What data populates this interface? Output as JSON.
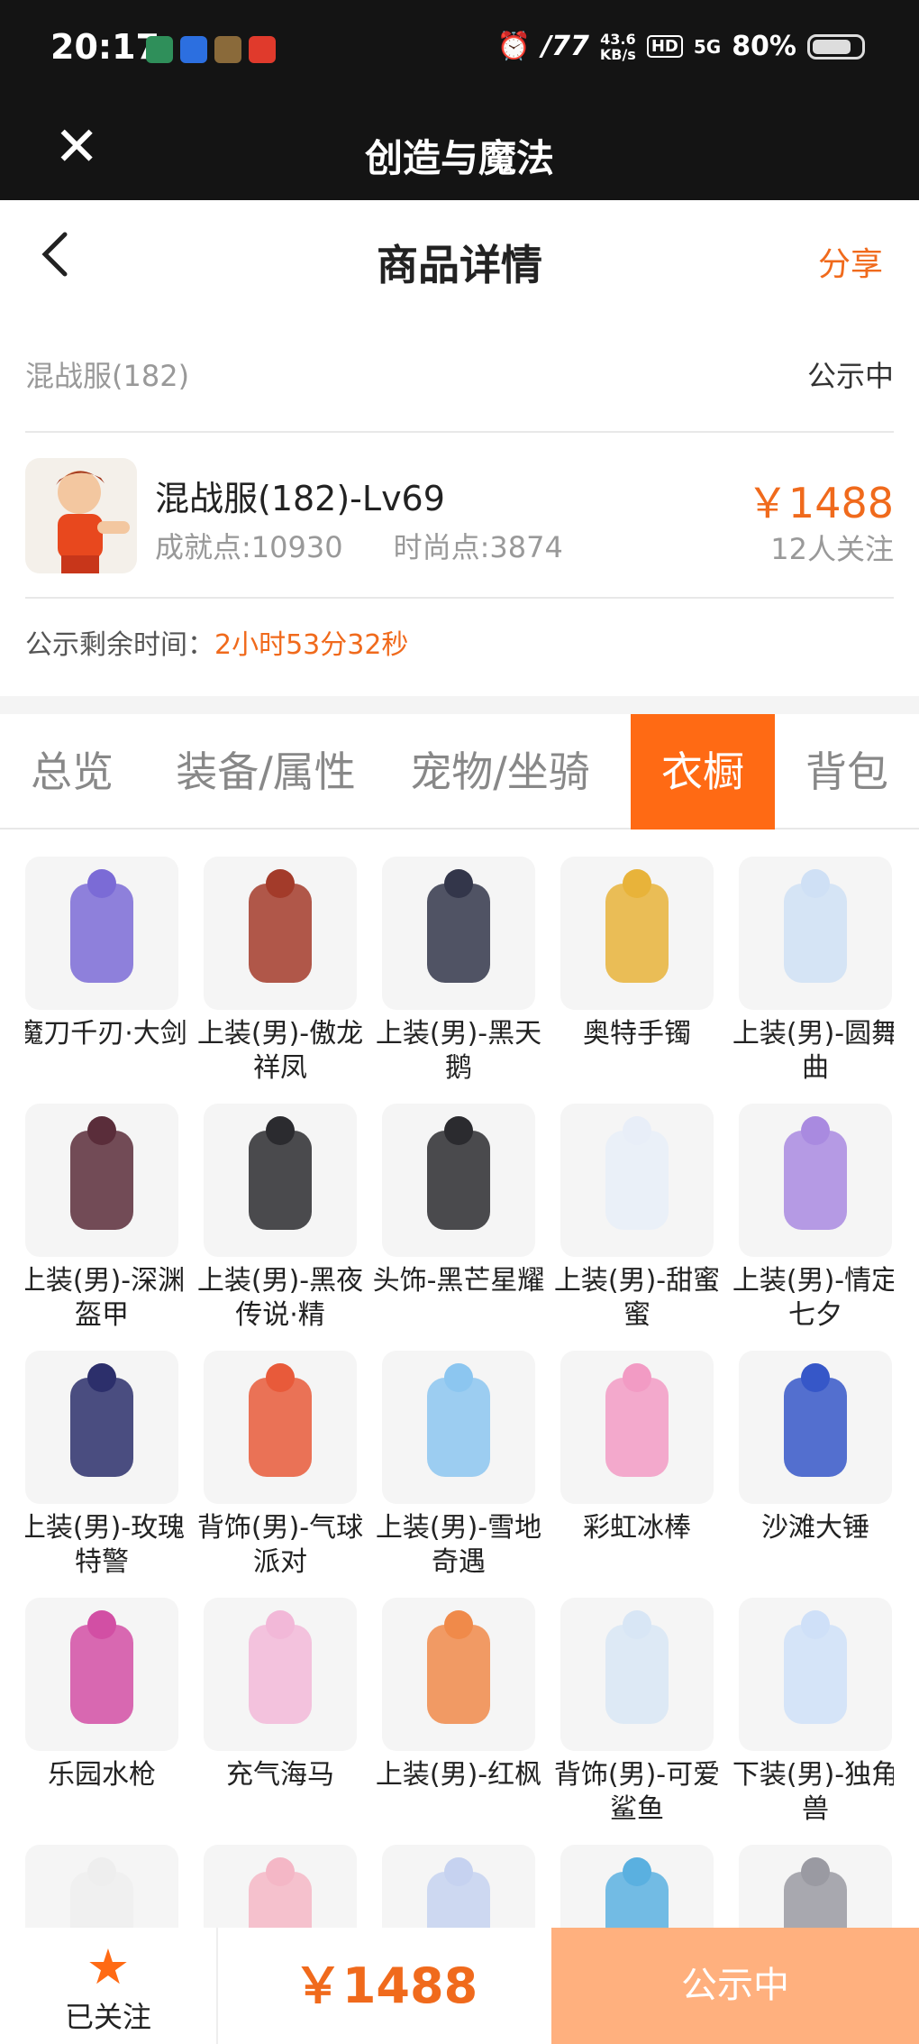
{
  "status_bar": {
    "time": "20:17",
    "net_speed_value": "43.6",
    "net_speed_unit": "KB/s",
    "hd": "HD",
    "signal": "5G",
    "battery": "80%",
    "battery_level": 0.8
  },
  "app_bar": {
    "title": "创造与魔法"
  },
  "nav": {
    "title": "商品详情",
    "share_label": "分享"
  },
  "server": {
    "name": "混战服(182)",
    "status": "公示中"
  },
  "product": {
    "name": "混战服(182)-Lv69",
    "achievement": "成就点:10930",
    "fashion": "时尚点:3874",
    "price": "￥1488",
    "watchers": "12人关注"
  },
  "countdown": {
    "label": "公示剩余时间：",
    "value": "2小时53分32秒"
  },
  "tabs": [
    "总览",
    "装备/属性",
    "宠物/坐骑",
    "衣橱",
    "背包"
  ],
  "active_tab": "衣橱",
  "wardrobe": [
    "魔刀千刃·大剑",
    "上装(男)-傲龙祥凤",
    "上装(男)-黑天鹅",
    "奥特手镯",
    "上装(男)-圆舞曲",
    "上装(男)-深渊盔甲",
    "上装(男)-黑夜传说·精",
    "头饰-黑芒星耀",
    "上装(男)-甜蜜蜜",
    "上装(男)-情定七夕",
    "上装(男)-玫瑰特警",
    "背饰(男)-气球派对",
    "上装(男)-雪地奇遇",
    "彩虹冰棒",
    "沙滩大锤",
    "乐园水枪",
    "充气海马",
    "上装(男)-红枫",
    "背饰(男)-可爱鲨鱼",
    "下装(男)-独角兽",
    "",
    "",
    "",
    "",
    ""
  ],
  "bottom_bar": {
    "follow_label": "已关注",
    "price": "￥1488",
    "status": "公示中"
  },
  "colors": {
    "accent": "#ff6a14",
    "price": "#f06a1c",
    "dark_bar": "#141414"
  }
}
